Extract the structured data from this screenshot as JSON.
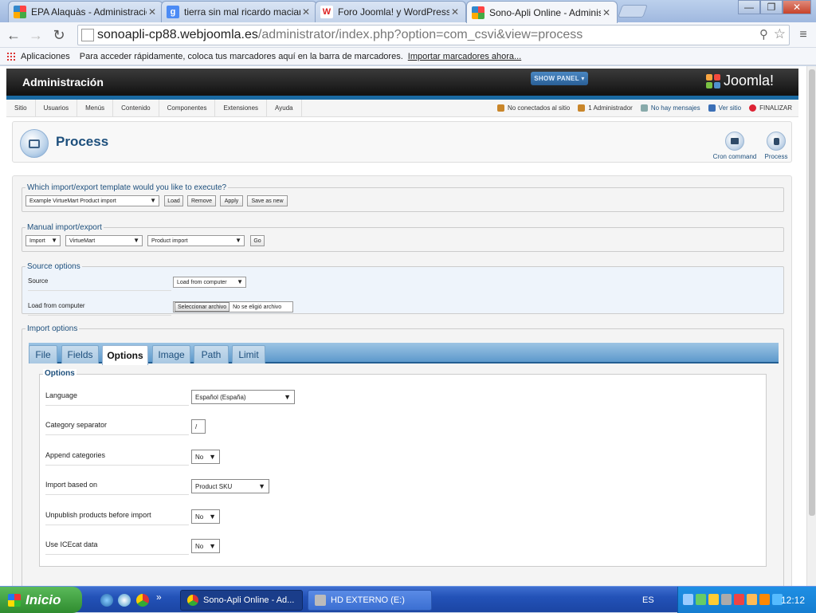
{
  "browser": {
    "tabs": [
      {
        "title": "EPA Alaquàs - Administración",
        "active": false,
        "favicon": "joomla-icon"
      },
      {
        "title": "tierra sin mal ricardo macian",
        "active": false,
        "favicon": "google-icon"
      },
      {
        "title": "Foro Joomla! y WordPress :",
        "active": false,
        "favicon": "forum-icon"
      },
      {
        "title": "Sono-Apli Online - Administra",
        "active": true,
        "favicon": "joomla-icon"
      }
    ],
    "url_host": "sonoapli-cp88.webjoomla.es",
    "url_path": "/administrator/index.php?option=com_csvi&view=process",
    "bookmarks": {
      "apps_label": "Aplicaciones",
      "hint": "Para acceder rápidamente, coloca tus marcadores aquí en la barra de marcadores.",
      "import_link": "Importar marcadores ahora..."
    }
  },
  "admin": {
    "title": "Administración",
    "show_panel": "SHOW PANEL",
    "brand": "Joomla!",
    "menu": [
      "Sitio",
      "Usuarios",
      "Menús",
      "Contenido",
      "Componentes",
      "Extensiones",
      "Ayuda"
    ],
    "status": {
      "visitors": "No conectados al sitio",
      "admins": "1 Administrador",
      "messages": "No hay mensajes",
      "view_site": "Ver sitio",
      "logout": "FINALIZAR"
    }
  },
  "page": {
    "title": "Process",
    "toolbar": {
      "cron": "Cron command",
      "process": "Process"
    }
  },
  "template_section": {
    "legend": "Which import/export template would you like to execute?",
    "selected_template": "Example VirtueMart Product import",
    "buttons": {
      "load": "Load",
      "remove": "Remove",
      "apply": "Apply",
      "save_as_new": "Save as new"
    }
  },
  "manual_section": {
    "legend": "Manual import/export",
    "action": "Import",
    "component": "VirtueMart",
    "operation": "Product import",
    "go": "Go"
  },
  "source_section": {
    "legend": "Source options",
    "source_label": "Source",
    "source_value": "Load from computer",
    "file_label": "Load from computer",
    "file_button": "Seleccionar archivo",
    "file_status": "No se eligió archivo"
  },
  "import_section": {
    "legend": "Import options",
    "tabs": [
      "File",
      "Fields",
      "Options",
      "Image",
      "Path",
      "Limit"
    ],
    "active_tab": "Options",
    "options_legend": "Options",
    "options": [
      {
        "label": "Language",
        "value": "Español (España)",
        "type": "select"
      },
      {
        "label": "Category separator",
        "value": "/",
        "type": "text"
      },
      {
        "label": "Append categories",
        "value": "No",
        "type": "select"
      },
      {
        "label": "Import based on",
        "value": "Product SKU",
        "type": "select"
      },
      {
        "label": "Unpublish products before import",
        "value": "No",
        "type": "select"
      },
      {
        "label": "Use ICEcat data",
        "value": "No",
        "type": "select"
      }
    ]
  },
  "taskbar": {
    "start": "Inicio",
    "tasks": [
      {
        "label": "Sono-Apli Online - Ad...",
        "active": true
      },
      {
        "label": "HD EXTERNO (E:)",
        "active": false
      }
    ],
    "lang": "ES",
    "clock": "12:12"
  }
}
